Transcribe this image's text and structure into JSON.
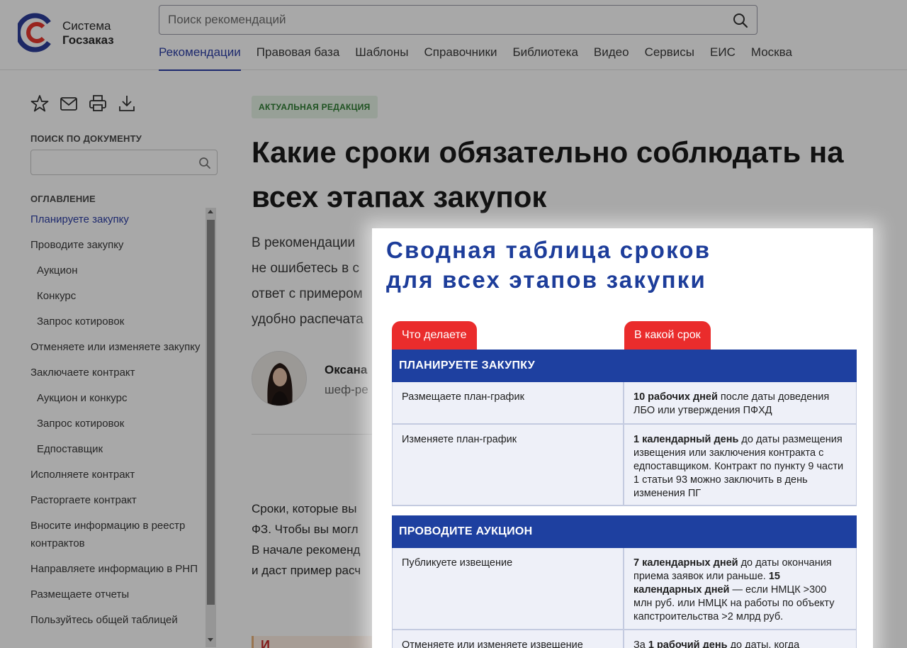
{
  "header": {
    "logo_line1": "Система",
    "logo_line2": "Госзаказ",
    "search_placeholder": "Поиск рекомендаций",
    "nav": [
      "Рекомендации",
      "Правовая база",
      "Шаблоны",
      "Справочники",
      "Библиотека",
      "Видео",
      "Сервисы",
      "ЕИС",
      "Москва"
    ],
    "nav_active": "Рекомендации"
  },
  "sidebar": {
    "tool_icons": [
      "star-icon",
      "mail-icon",
      "print-icon",
      "download-icon"
    ],
    "doc_search_label": "ПОИСК ПО ДОКУМЕНТУ",
    "toc_label": "ОГЛАВЛЕНИЕ",
    "toc": [
      {
        "label": "Планируете закупку",
        "level": 0,
        "active": true
      },
      {
        "label": "Проводите закупку",
        "level": 0
      },
      {
        "label": "Аукцион",
        "level": 1
      },
      {
        "label": "Конкурс",
        "level": 1
      },
      {
        "label": "Запрос котировок",
        "level": 1
      },
      {
        "label": "Отменяете или изменяете закупку",
        "level": 0
      },
      {
        "label": "Заключаете контракт",
        "level": 0
      },
      {
        "label": "Аукцион и конкурс",
        "level": 1
      },
      {
        "label": "Запрос котировок",
        "level": 1
      },
      {
        "label": "Едпоставщик",
        "level": 1
      },
      {
        "label": "Исполняете контракт",
        "level": 0
      },
      {
        "label": "Расторгаете контракт",
        "level": 0
      },
      {
        "label": "Вносите информацию в реестр контрактов",
        "level": 0
      },
      {
        "label": "Направляете информацию в РНП",
        "level": 0
      },
      {
        "label": "Размещаете отчеты",
        "level": 0
      },
      {
        "label": "Пользуйтесь общей таблицей",
        "level": 0
      }
    ]
  },
  "main": {
    "badge": "АКТУАЛЬНАЯ РЕДАКЦИЯ",
    "title": "Какие сроки обязательно соблюдать на всех этапах закупок",
    "intro_lines": [
      "В рекомендации",
      "не ошибетесь в с",
      "ответ с примером",
      "удобно распечата"
    ],
    "author_name": "Оксана",
    "author_role": "шеф-ре",
    "body_lines": [
      "Сроки, которые вы",
      "ФЗ. Чтобы вы могл",
      "В начале рекоменд",
      "и даст пример расч"
    ],
    "callout_text": "И"
  },
  "popup": {
    "title_line1": "Сводная таблица сроков",
    "title_line2": "для всех этапов закупки",
    "col1_label": "Что делаете",
    "col2_label": "В какой срок",
    "section1": {
      "heading": "ПЛАНИРУЕТЕ ЗАКУПКУ",
      "rows": [
        {
          "action": "Размещаете план-график",
          "term_bold": "10 рабочих дней",
          "term_rest": " после даты доведения ЛБО или утверждения ПФХД"
        },
        {
          "action": "Изменяете план-график",
          "term_bold": "1 календарный день",
          "term_rest": " до даты размещения извещения или заключения контракта с едпоставщиком. Контракт по пункту 9 части 1 статьи 93 можно заключить в день изменения ПГ"
        }
      ]
    },
    "section2": {
      "heading": "ПРОВОДИТЕ АУКЦИОН",
      "rows": [
        {
          "action": "Публикуете извещение",
          "term_bold": "7 календарных дней",
          "term_mid": " до даты окончания приема заявок или раньше. ",
          "term_bold2": "15 календарных дней",
          "term_rest": " — если НМЦК >300 млн руб. или НМЦК на работы по объекту капстроительства >2 млрд руб."
        },
        {
          "action": "Отменяете или изменяете извещение",
          "term_pre": "За ",
          "term_bold": "1 рабочий день",
          "term_rest": " до даты, когда"
        }
      ]
    },
    "colors": {
      "title": "#1d3d9a",
      "tab": "#ea2c2c",
      "section": "#1e40a0",
      "row_bg": "#eef0f8"
    }
  }
}
